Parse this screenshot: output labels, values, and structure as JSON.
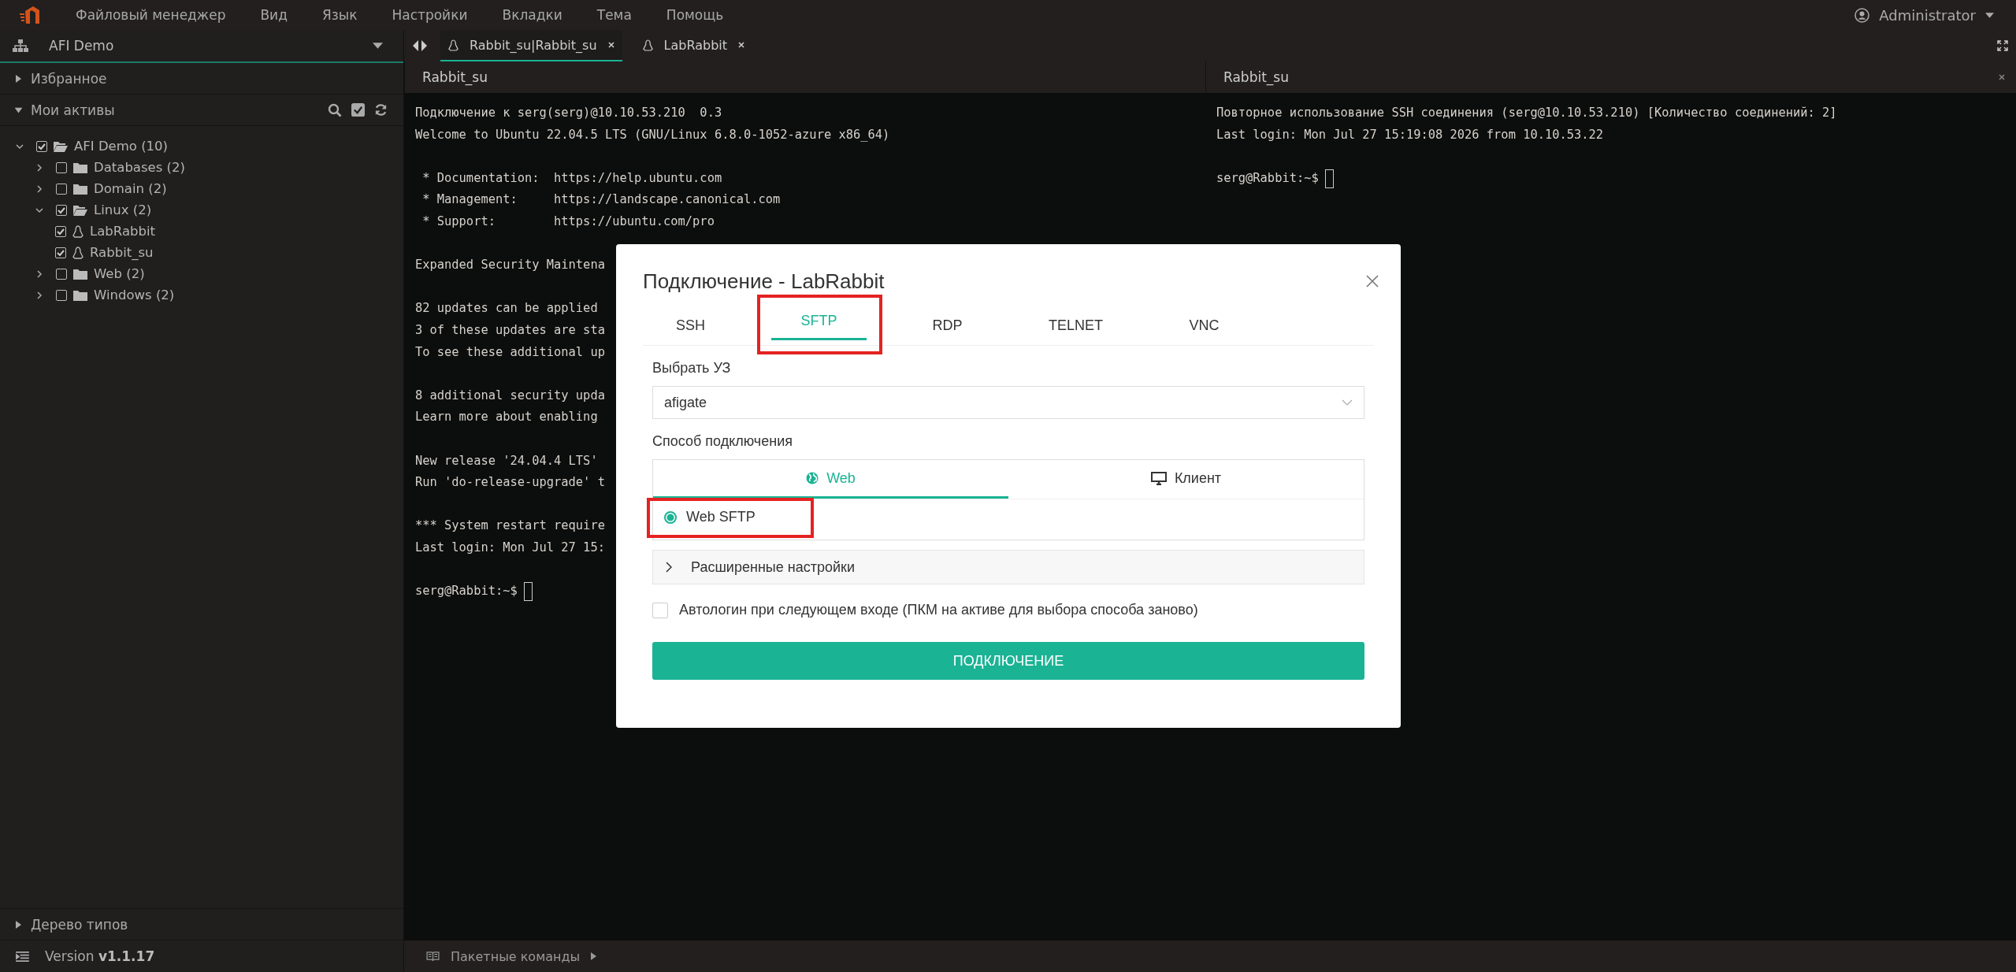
{
  "menu": [
    "Файловый менеджер",
    "Вид",
    "Язык",
    "Настройки",
    "Вкладки",
    "Тема",
    "Помощь"
  ],
  "user": {
    "name": "Administrator"
  },
  "sidebar": {
    "workspace": "AFI Demo",
    "favorites": {
      "label": "Избранное",
      "expanded": false
    },
    "assets": {
      "label": "Мои активы",
      "expanded": true
    },
    "tree": [
      {
        "label": "AFI Demo (10)",
        "kind": "folder",
        "checked": true,
        "expanded": true,
        "children": [
          {
            "label": "Databases (2)",
            "kind": "folder",
            "checked": false,
            "expanded": false
          },
          {
            "label": "Domain (2)",
            "kind": "folder",
            "checked": false,
            "expanded": false
          },
          {
            "label": "Linux (2)",
            "kind": "folder",
            "checked": true,
            "expanded": true,
            "children": [
              {
                "label": "LabRabbit",
                "kind": "host",
                "checked": true
              },
              {
                "label": "Rabbit_su",
                "kind": "host",
                "checked": true
              }
            ]
          },
          {
            "label": "Web (2)",
            "kind": "folder",
            "checked": false,
            "expanded": false
          },
          {
            "label": "Windows (2)",
            "kind": "folder",
            "checked": false,
            "expanded": false
          }
        ]
      }
    ],
    "types_tree": {
      "label": "Дерево типов",
      "expanded": false
    },
    "version": {
      "label": "Version",
      "value": "v1.1.17"
    }
  },
  "tabs": [
    {
      "label": "Rabbit_su|Rabbit_su",
      "selected": true
    },
    {
      "label": "LabRabbit",
      "selected": false
    }
  ],
  "panes": [
    {
      "title": "Rabbit_su",
      "closable": false,
      "blocks": [
        [
          "Подключение к serg(serg)@10.10.53.210  0.3",
          "Welcome to Ubuntu 22.04.5 LTS (GNU/Linux 6.8.0-1052-azure x86_64)"
        ],
        [
          " * Documentation:  https://help.ubuntu.com",
          " * Management:     https://landscape.canonical.com",
          " * Support:        https://ubuntu.com/pro"
        ],
        [
          "Expanded Security Maintena"
        ],
        [
          "82 updates can be applied",
          "3 of these updates are sta",
          "To see these additional up"
        ],
        [
          "8 additional security upda",
          "Learn more about enabling"
        ],
        [
          "New release '24.04.4 LTS'",
          "Run 'do-release-upgrade' t"
        ],
        [
          "*** System restart require",
          "Last login: Mon Jul 27 15:"
        ]
      ],
      "prompt": "serg@Rabbit:~$"
    },
    {
      "title": "Rabbit_su",
      "closable": true,
      "blocks": [
        [
          "Повторное использование SSH соединения (serg@10.10.53.210) [Количество соединений: 2]",
          "Last login: Mon Jul 27 15:19:08 2026 from 10.10.53.22"
        ]
      ],
      "prompt": "serg@Rabbit:~$"
    }
  ],
  "bottom_bar": {
    "label": "Пакетные команды"
  },
  "dialog": {
    "title": "Подключение - LabRabbit",
    "tabs": [
      {
        "label": "SSH",
        "selected": false,
        "highlighted": false
      },
      {
        "label": "SFTP",
        "selected": true,
        "highlighted": true
      },
      {
        "label": "RDP",
        "selected": false,
        "highlighted": false
      },
      {
        "label": "TELNET",
        "selected": false,
        "highlighted": false
      },
      {
        "label": "VNC",
        "selected": false,
        "highlighted": false
      }
    ],
    "account": {
      "label": "Выбрать УЗ",
      "value": "afigate"
    },
    "method": {
      "label": "Способ подключения",
      "tabs": [
        {
          "label": "Web",
          "kind": "web",
          "selected": true
        },
        {
          "label": "Клиент",
          "kind": "client",
          "selected": false
        }
      ],
      "options": [
        {
          "label": "Web SFTP",
          "selected": true,
          "highlighted": true
        }
      ]
    },
    "advanced": {
      "label": "Расширенные настройки",
      "expanded": false
    },
    "autologin": {
      "label": "Автологин при следующем входе (ПКМ на активе для выбора способа заново)",
      "checked": false
    },
    "submit": "ПОДКЛЮЧЕНИЕ"
  }
}
